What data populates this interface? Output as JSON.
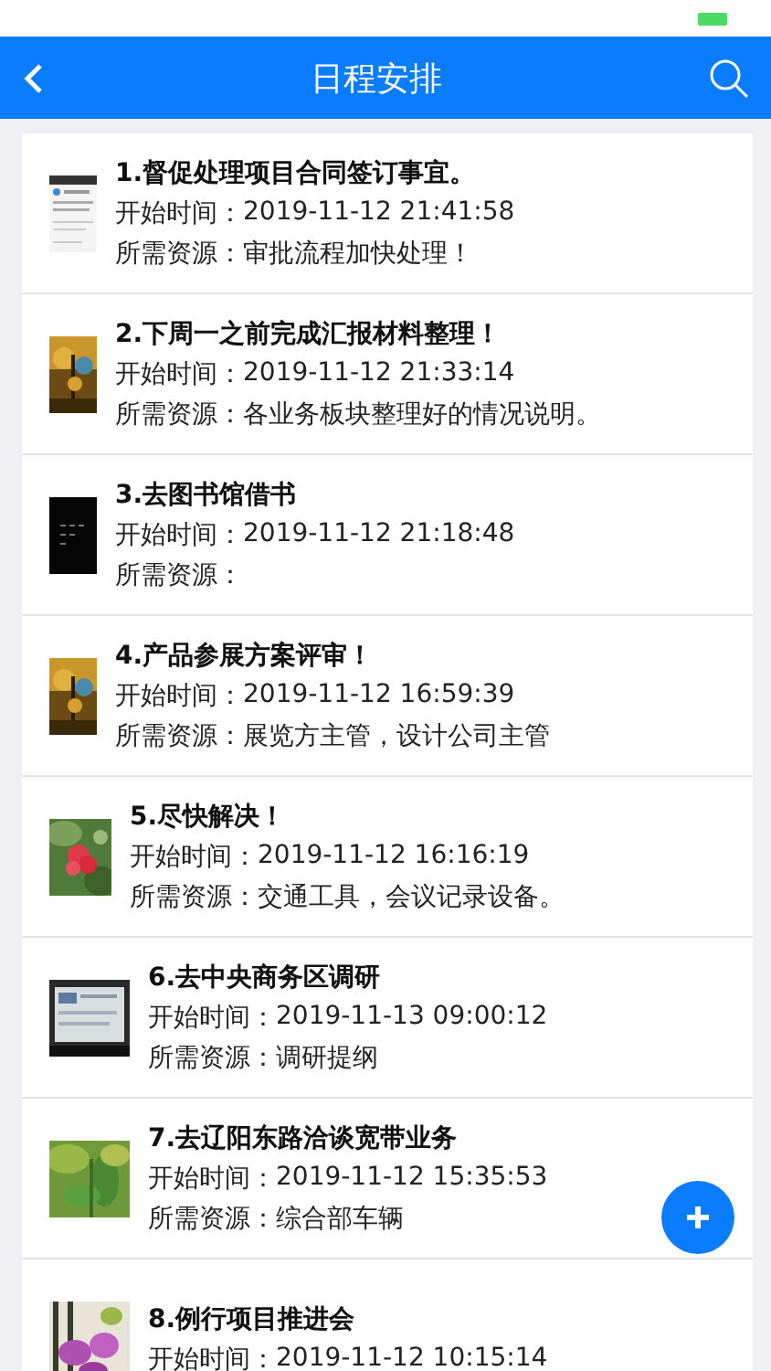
{
  "nav_bar": {
    "title": "日程安排"
  },
  "schedule": [
    {
      "title": "1.督促处理项目合同签订事宜。",
      "start_label": "开始时间：",
      "start_time": "2019-11-12 21:41:58",
      "resource_label": "所需资源：",
      "resource": "审批流程加快处理！",
      "thumb": {
        "kind": "document"
      }
    },
    {
      "title": "2.下周一之前完成汇报材料整理！",
      "start_label": "开始时间：",
      "start_time": "2019-11-12 21:33:14",
      "resource_label": "所需资源：",
      "resource": "各业务板块整理好的情况说明。",
      "thumb": {
        "kind": "forest"
      }
    },
    {
      "title": "3.去图书馆借书",
      "start_label": "开始时间：",
      "start_time": "2019-11-12 21:18:48",
      "resource_label": "所需资源：",
      "thumb": {
        "kind": "dark"
      }
    },
    {
      "title": "4.产品参展方案评审！",
      "start_label": "开始时间：",
      "start_time": "2019-11-12 16:59:39",
      "resource_label": "所需资源：",
      "resource": "展览方主管，设计公司主管",
      "thumb": {
        "kind": "forest"
      }
    },
    {
      "title": "5.尽快解决！",
      "start_label": "开始时间：",
      "start_time": "2019-11-12 16:16:19",
      "resource_label": "所需资源：",
      "resource": "交通工具，会议记录设备。",
      "thumb": {
        "kind": "flower"
      }
    },
    {
      "title": "6.去中央商务区调研",
      "start_label": "开始时间：",
      "start_time": "2019-11-13 09:00:12",
      "resource_label": "所需资源：",
      "resource": "调研提纲",
      "thumb": {
        "kind": "screen"
      }
    },
    {
      "title": "7.去辽阳东路洽谈宽带业务",
      "start_label": "开始时间：",
      "start_time": "2019-11-12 15:35:53",
      "resource_label": "所需资源：",
      "resource": "综合部车辆",
      "thumb": {
        "kind": "leaves"
      }
    },
    {
      "title": "8.例行项目推进会",
      "start_label": "开始时间：",
      "start_time": "2019-11-12 10:15:14",
      "thumb": {
        "kind": "orchid"
      }
    }
  ]
}
